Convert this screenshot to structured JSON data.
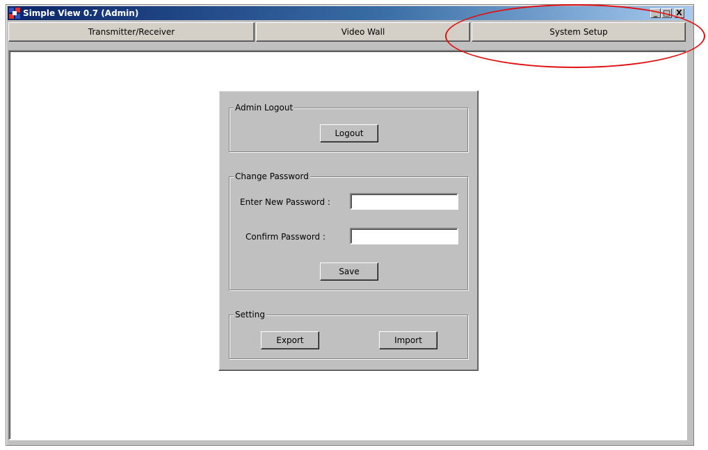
{
  "window": {
    "title": "Simple View 0.7 (Admin)",
    "controls": {
      "minimize": "_",
      "maximize": "□",
      "close": "X"
    }
  },
  "nav": {
    "tabs": [
      {
        "label": "Transmitter/Receiver"
      },
      {
        "label": "Video Wall"
      },
      {
        "label": "System Setup"
      }
    ]
  },
  "admin_logout": {
    "legend": "Admin Logout",
    "logout_button": "Logout"
  },
  "change_password": {
    "legend": "Change Password",
    "new_password_label": "Enter New Password :",
    "new_password_value": "",
    "confirm_password_label": "Confirm Password :",
    "confirm_password_value": "",
    "save_button": "Save"
  },
  "setting": {
    "legend": "Setting",
    "export_button": "Export",
    "import_button": "Import"
  },
  "annotation": {
    "color": "#e01010",
    "highlights": "System Setup"
  },
  "colors": {
    "titlebar_start": "#0a246a",
    "titlebar_end": "#a6caf0",
    "face": "#c0c0c0"
  }
}
